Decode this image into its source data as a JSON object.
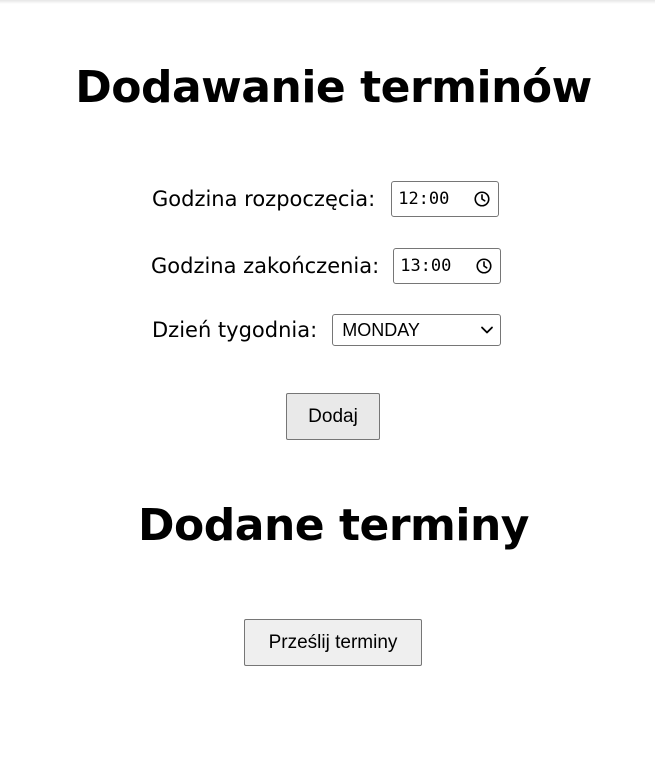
{
  "form": {
    "title": "Dodawanie terminów",
    "start_label": "Godzina rozpoczęcia:",
    "start_value": "12:00",
    "end_label": "Godzina zakończenia:",
    "end_value": "13:00",
    "day_label": "Dzień tygodnia:",
    "day_selected": "MONDAY",
    "add_button": "Dodaj"
  },
  "list": {
    "title": "Dodane terminy",
    "send_button": "Prześlij terminy"
  },
  "icons": {
    "time": "clock-icon",
    "select": "chevron-down-icon"
  }
}
